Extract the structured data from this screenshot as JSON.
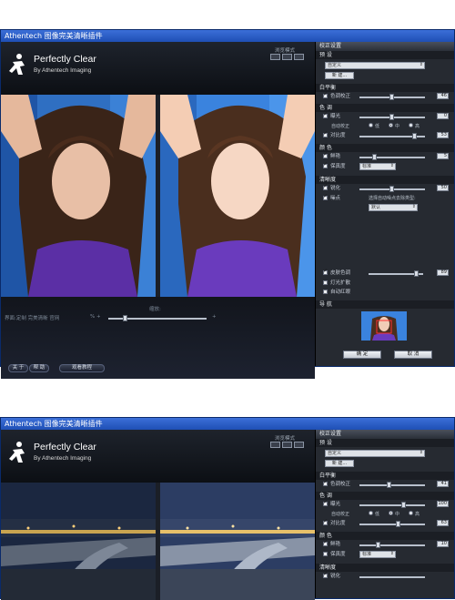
{
  "colors": {
    "titlebar": "#2a5fd0",
    "panel_bg": "#262a31",
    "slider_track": "#b8c0cc"
  },
  "windows": [
    {
      "title": "Athentech 图像完美清晰插件",
      "logo": {
        "title": "Perfectly Clear",
        "subtitle": "By Athentech Imaging"
      },
      "view_mode_label": "浏览模式",
      "panel": {
        "header": "校正设置",
        "preset": {
          "label": "预 设",
          "value": "自定义",
          "new_button": "新 建..."
        },
        "white_balance": {
          "label": "白平衡",
          "rows": [
            {
              "label": "色调校正",
              "checked": true,
              "value": "46"
            }
          ]
        },
        "tone": {
          "label": "色 调",
          "rows": [
            {
              "label": "曝光",
              "checked": true,
              "value": "0"
            },
            {
              "label": "对比度",
              "checked": true,
              "value": "53"
            }
          ],
          "auto_label": "自动校正",
          "radio_options": [
            "低",
            "中",
            "高"
          ],
          "radio_selected": "中"
        },
        "color": {
          "label": "颜 色",
          "rows": [
            {
              "label": "鲜艳",
              "checked": true,
              "value": "5"
            }
          ],
          "fidelity": {
            "label": "保真度",
            "checked": true,
            "value": "标准"
          }
        },
        "sharpness": {
          "label": "清晰度",
          "rows": [
            {
              "label": "锐化",
              "checked": true,
              "value": "50"
            }
          ],
          "noise": {
            "label": "噪点",
            "checked": true
          },
          "noise_hint": "选择自动噪点去除类型:",
          "noise_value": "默认"
        },
        "extra": [
          {
            "label": "皮肤色调",
            "checked": true,
            "value": "89"
          },
          {
            "label": "灯光扩散",
            "checked": false
          },
          {
            "label": "自动红眼",
            "checked": false
          }
        ],
        "nav_label": "导 航",
        "ok_button": "确 定",
        "cancel_button": "取 消"
      },
      "bottom": {
        "zoom_label": "缩放:",
        "left_text": "界面:定制 完美清晰 官网",
        "percent_label": "% +",
        "about_button": "关 于",
        "help_button": "帮 助",
        "tutorial_button": "观看教程"
      }
    },
    {
      "title": "Athentech 图像完美清晰插件",
      "logo": {
        "title": "Perfectly Clear",
        "subtitle": "By Athentech Imaging"
      },
      "view_mode_label": "浏览模式",
      "panel": {
        "header": "校正设置",
        "preset": {
          "label": "预 设",
          "value": "自定义",
          "new_button": "新 建..."
        },
        "white_balance": {
          "label": "白平衡",
          "rows": [
            {
              "label": "色调校正",
              "checked": true,
              "value": "41"
            }
          ]
        },
        "tone": {
          "label": "色 调",
          "rows": [
            {
              "label": "曝光",
              "checked": true,
              "value": "100"
            },
            {
              "label": "对比度",
              "checked": true,
              "value": "63"
            }
          ],
          "auto_label": "自动校正",
          "radio_options": [
            "低",
            "中",
            "高"
          ],
          "radio_selected": "中"
        },
        "color": {
          "label": "颜 色",
          "rows": [
            {
              "label": "鲜艳",
              "checked": true,
              "value": "10"
            }
          ],
          "fidelity": {
            "label": "保真度",
            "checked": false,
            "value": "标准"
          }
        },
        "sharpness": {
          "label": "清晰度",
          "rows": [
            {
              "label": "锐化",
              "checked": true,
              "value": ""
            }
          ]
        }
      }
    }
  ]
}
